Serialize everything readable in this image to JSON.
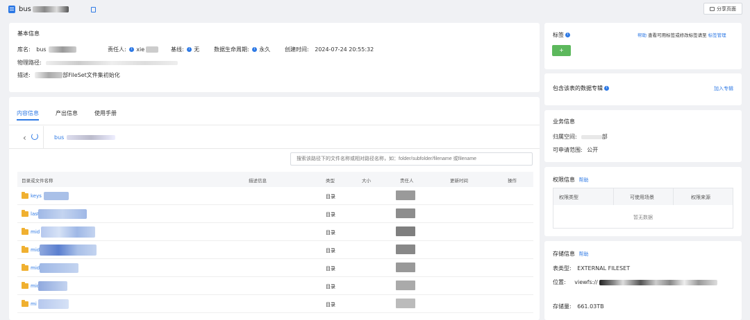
{
  "header": {
    "title": "bus",
    "share_label": "分享页面"
  },
  "basic_info": {
    "title": "基本信息",
    "db_label": "库名:",
    "db_value": "bus",
    "owner_label": "责任人:",
    "owner_value": "xie",
    "baseline_label": "基线:",
    "baseline_value": "无",
    "lifecycle_label": "数据生命周期:",
    "lifecycle_value": "永久",
    "created_label": "创建时间:",
    "created_value": "2024-07-24 20:55:32",
    "path_label": "物理路径:",
    "desc_label": "描述:",
    "desc_value": "部FileSet文件集初始化"
  },
  "tabs": [
    "内容信息",
    "产出信息",
    "使用手册"
  ],
  "content": {
    "path": "bus",
    "search_placeholder": "搜索该路径下的文件名称或相对路径名称，如：folder/subfolder/filename 或filename",
    "columns": [
      "目录或文件名称",
      "描述信息",
      "类型",
      "大小",
      "责任人",
      "更新时间",
      "操作"
    ],
    "rows": [
      {
        "name": "keys",
        "type": "目录"
      },
      {
        "name": "last",
        "type": "目录"
      },
      {
        "name": "mid",
        "type": "目录"
      },
      {
        "name": "mid",
        "type": "目录"
      },
      {
        "name": "mid",
        "type": "目录"
      },
      {
        "name": "mid",
        "type": "目录"
      },
      {
        "name": "mi",
        "type": "目录"
      }
    ]
  },
  "tags": {
    "title": "标签",
    "help": "帮助",
    "hint": "查看可用标签或修改标签请至",
    "manage": "标签管理",
    "add_label": "+"
  },
  "topics": {
    "title": "包含该表的数据专辑",
    "join": "加入专辑"
  },
  "business": {
    "title": "业务信息",
    "space_label": "归属空间:",
    "space_value": "部",
    "scope_label": "可申请范围:",
    "scope_value": "公开"
  },
  "permission": {
    "title": "权限信息",
    "help": "帮助",
    "columns": [
      "权限类型",
      "可使用场景",
      "权限来源"
    ],
    "empty": "暂无数据"
  },
  "storage": {
    "title": "存储信息",
    "help": "帮助",
    "type_label": "表类型:",
    "type_value": "EXTERNAL FILESET",
    "location_label": "位置:",
    "location_value": "viewfs://",
    "size_label": "存储量:",
    "size_value": "661.03TB"
  },
  "colors": {
    "accent": "#2f7ae5",
    "add_button": "#5cb85c",
    "folder": "#f0b030"
  }
}
